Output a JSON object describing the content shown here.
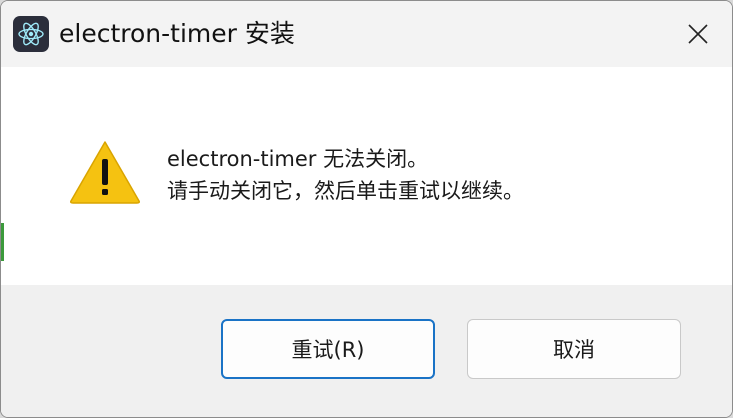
{
  "window": {
    "title": "electron-timer 安装",
    "app_icon": "electron-app-icon",
    "close_icon": "close-icon"
  },
  "content": {
    "icon": "warning-icon",
    "line1": "electron-timer 无法关闭。",
    "line2": "请手动关闭它，然后单击重试以继续。"
  },
  "buttons": {
    "retry_label": "重试(R)",
    "cancel_label": "取消"
  },
  "colors": {
    "primary_border": "#1a73c6",
    "warning_fill": "#f5c211",
    "titlebar_bg": "#f3f3f3",
    "footer_bg": "#f0f0f0"
  }
}
